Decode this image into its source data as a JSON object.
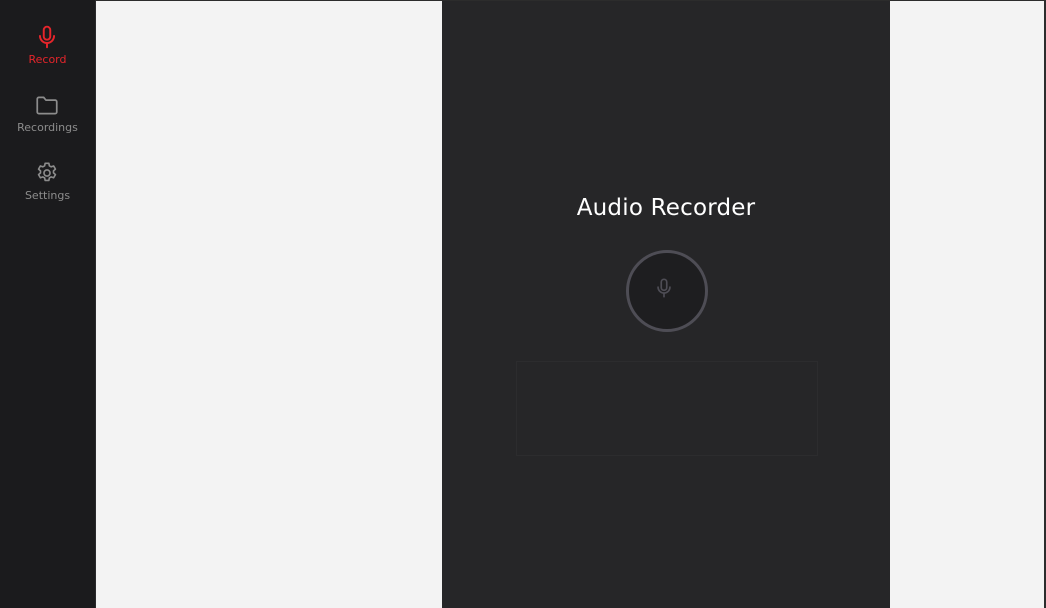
{
  "sidebar": {
    "items": [
      {
        "label": "Record",
        "icon": "microphone-icon",
        "active": true
      },
      {
        "label": "Recordings",
        "icon": "folder-icon",
        "active": false
      },
      {
        "label": "Settings",
        "icon": "gear-icon",
        "active": false
      }
    ]
  },
  "main": {
    "title": "Audio Recorder",
    "record_button_icon": "microphone-icon"
  },
  "colors": {
    "accent": "#e5252b",
    "sidebar_bg": "#1b1b1d",
    "panel_bg": "#262628",
    "page_bg": "#f3f3f3"
  }
}
